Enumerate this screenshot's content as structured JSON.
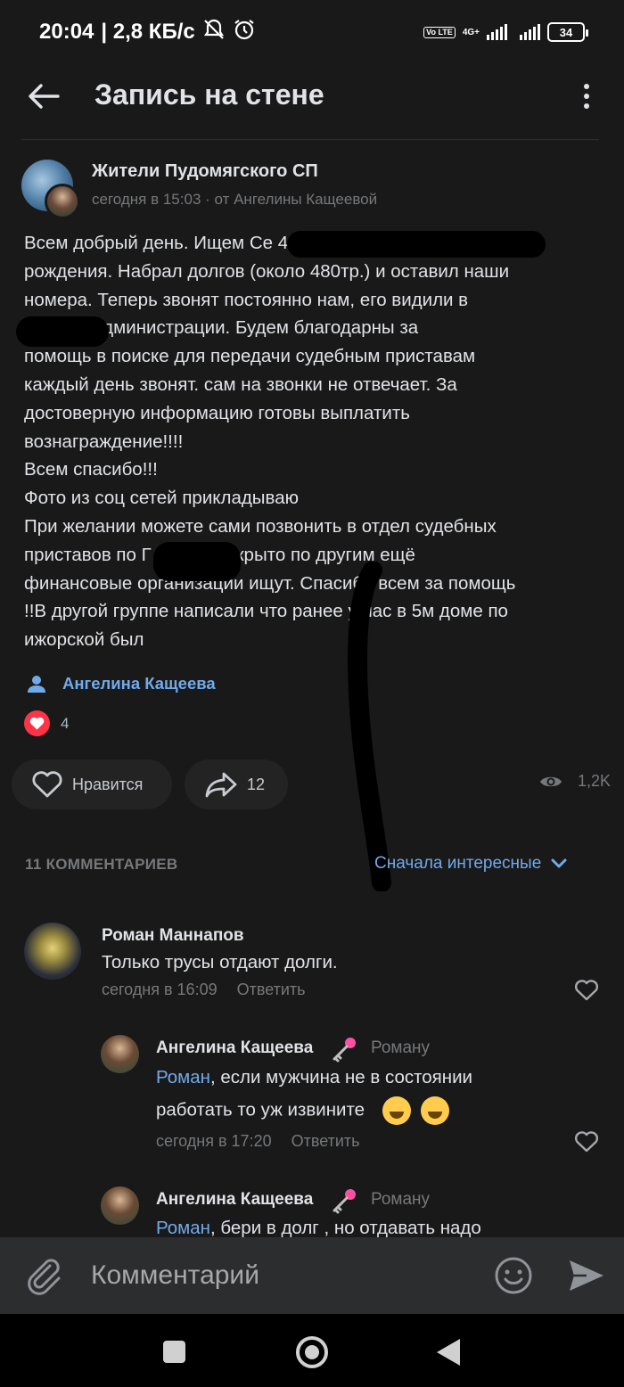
{
  "status_bar": {
    "time": "20:04",
    "speed": "| 2,8 КБ/с",
    "network": "4G+",
    "volte": "Vo LTE",
    "battery": "34"
  },
  "header": {
    "title": "Запись на стене"
  },
  "post": {
    "group_name": "Жители Пудомягского СП",
    "meta": "сегодня в 15:03 · от Ангелины Кащеевой",
    "lines": [
      "Всем добрый день. Ищем Се                                    4 года",
      "рождения. Набрал долгов (около 480тр.) и оставил наши",
      "номера. Теперь звонят постоянно нам, его видили в",
      "          х около администрации. Будем благодарны за",
      "помощь в поиске для передачи судебным приставам",
      "каждый день звонят. сам на звонки не отвечает. За",
      "достоверную информацию готовы выплатить",
      "вознаграждение!!!!",
      "Всем спасибо!!!",
      "Фото из соц сетей прикладываю",
      "При желании можете сами позвонить в отдел судебных",
      "приставов по Г         2 дела открыто по другим ещё",
      "финансовые организации ищут. Спасибо всем за помощь",
      "!!В другой группе написали что ранее у нас в 5м доме по",
      "ижорской был"
    ],
    "signer": "Ангелина Кащеева",
    "reactions_count": "4",
    "like_label": "Нравится",
    "share_count": "12",
    "views": "1,2K"
  },
  "comments_header": {
    "count_label": "11 КОММЕНТАРИЕВ",
    "sort_label": "Сначала интересные"
  },
  "comments": [
    {
      "author": "Роман Маннапов",
      "text": "Только трусы отдают долги.",
      "time": "сегодня в 16:09",
      "reply_label": "Ответить"
    },
    {
      "author": "Ангелина Кащеева",
      "reply_to": "Роману",
      "mention": "Роман",
      "text_line1": ", если мужчина не в состоянии",
      "text_line2": "работать то уж извините",
      "time": "сегодня в 17:20",
      "reply_label": "Ответить"
    },
    {
      "author": "Ангелина Кащеева",
      "reply_to": "Роману",
      "mention": "Роман",
      "text_line1": ", бери в долг , но отдавать надо"
    }
  ],
  "input": {
    "placeholder": "Комментарий"
  },
  "colors": {
    "background": "#19191a",
    "accent": "#71aaeb",
    "like_red": "#ff3347",
    "secondary_text": "#76787a"
  }
}
